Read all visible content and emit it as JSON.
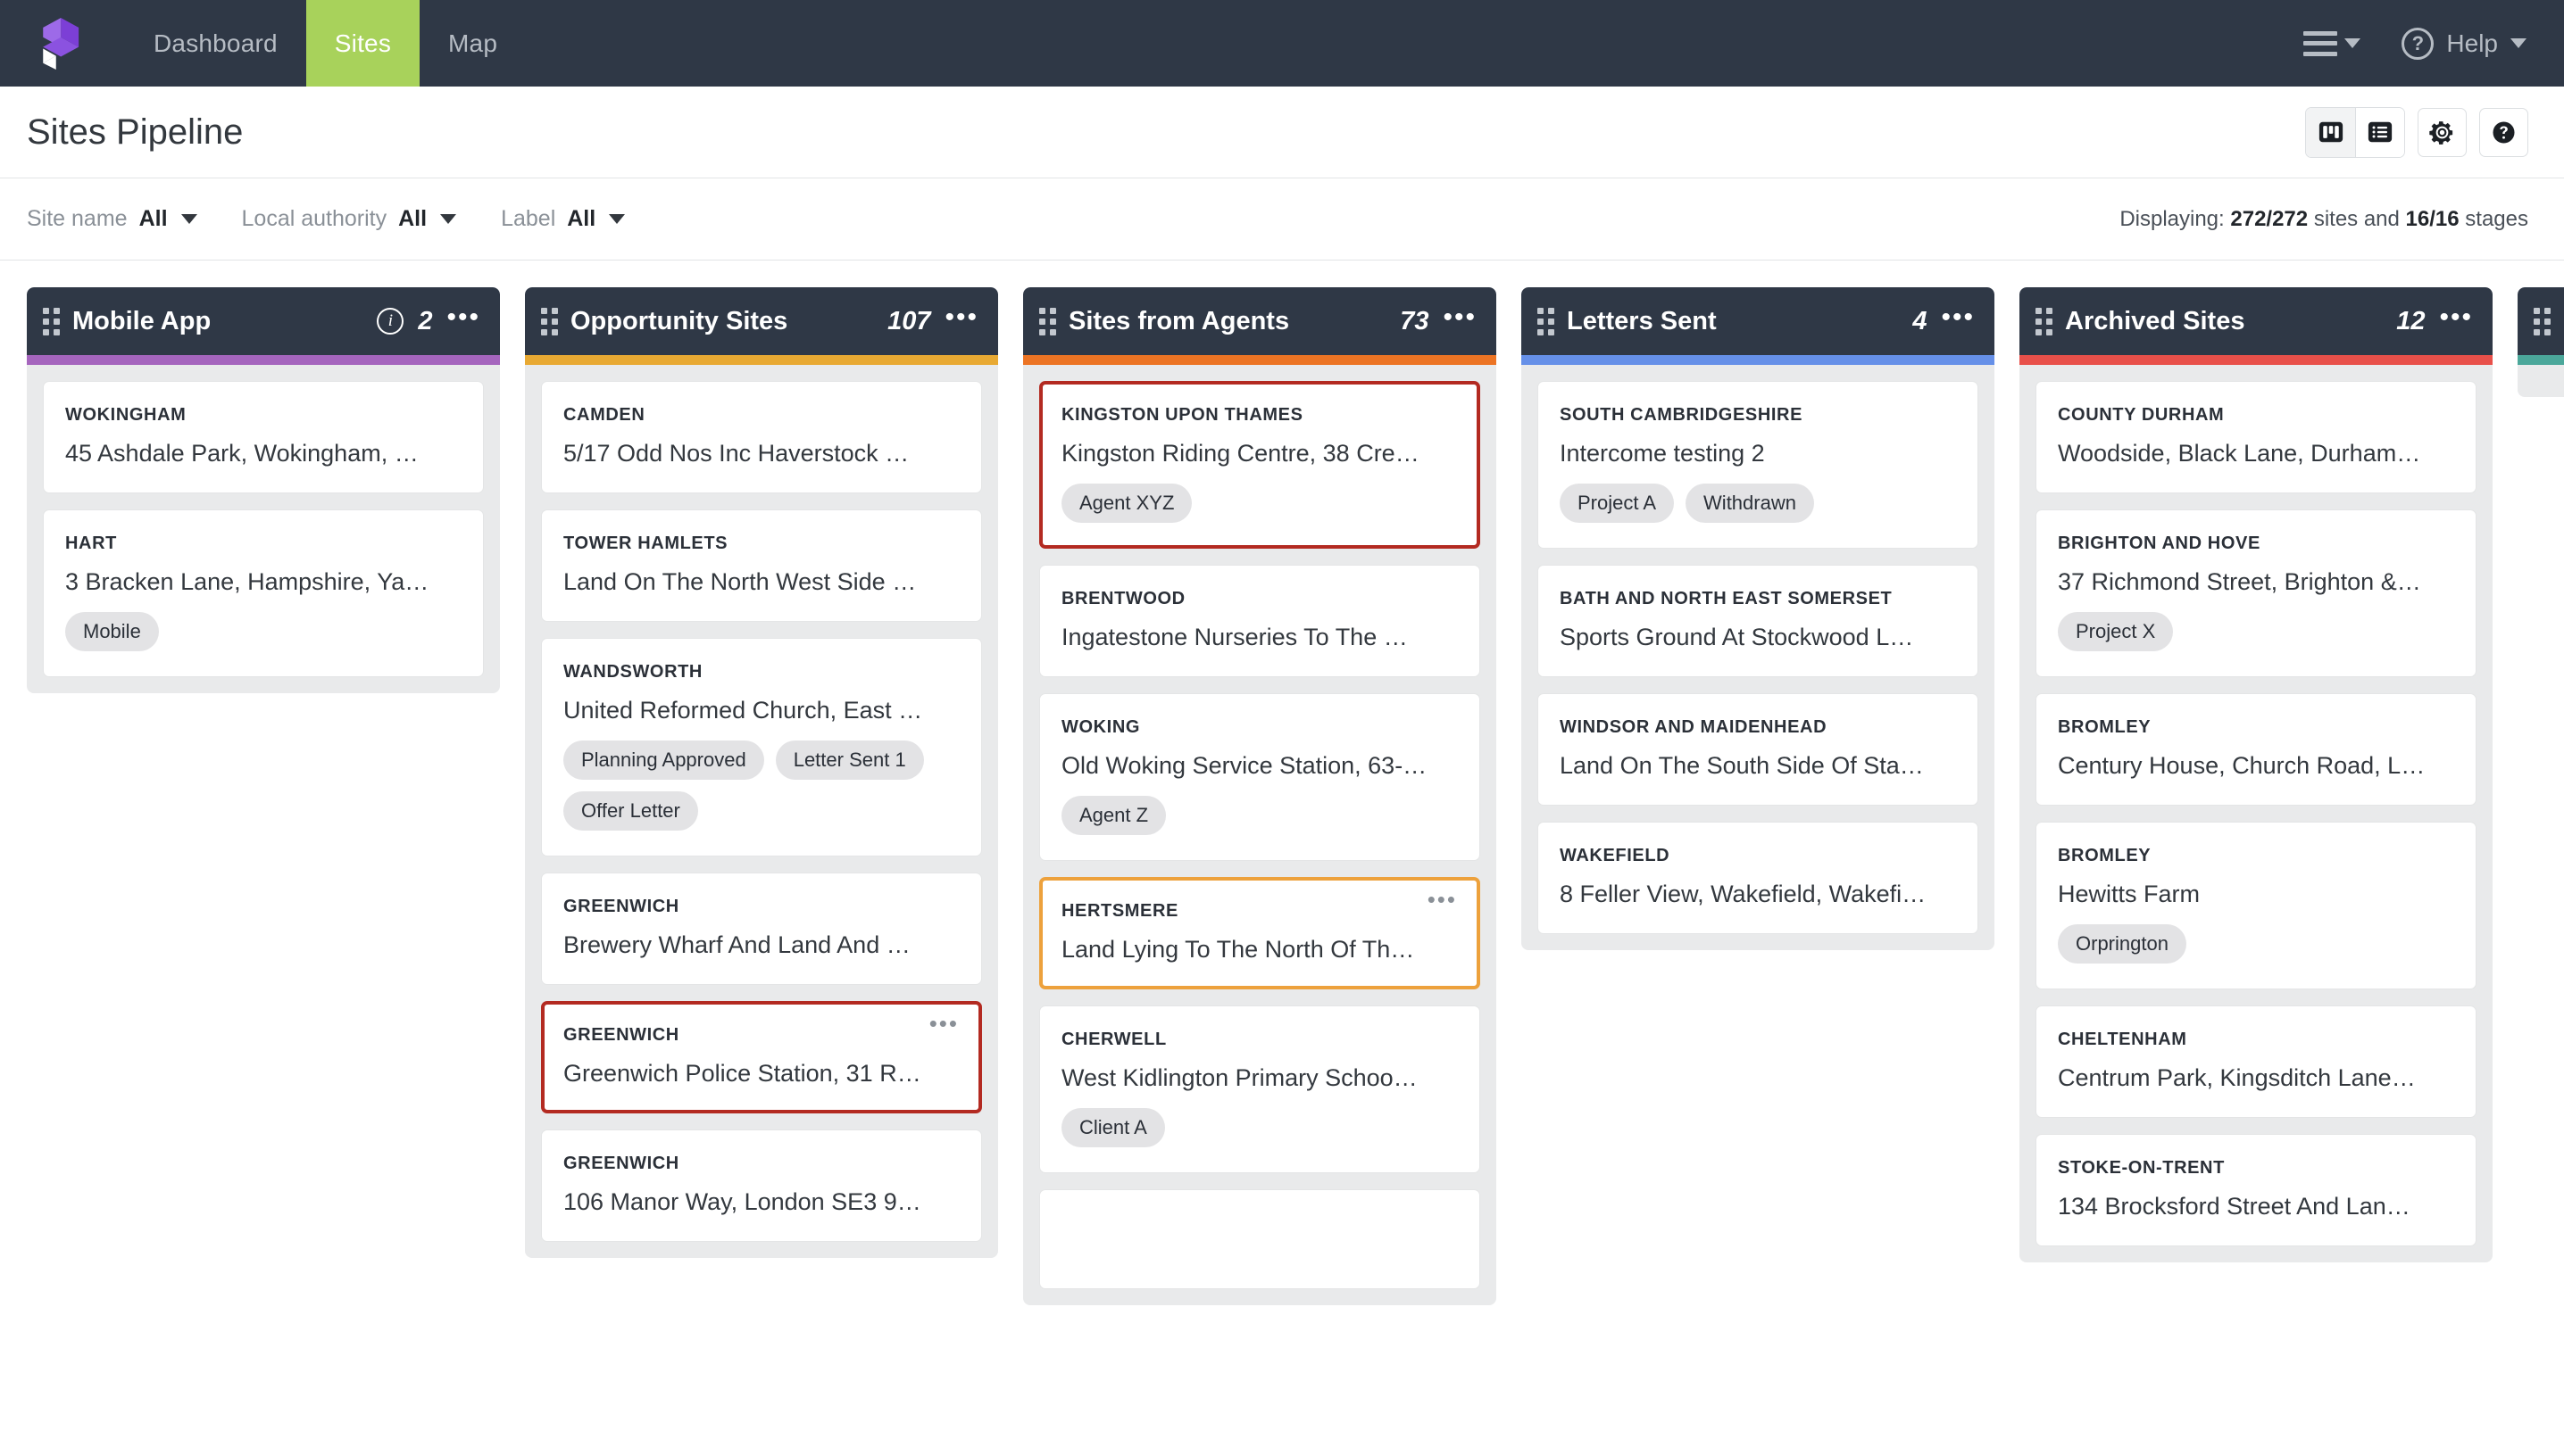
{
  "topnav": {
    "logo": "kanban-cube-logo",
    "items": [
      {
        "label": "Dashboard",
        "active": false
      },
      {
        "label": "Sites",
        "active": true
      },
      {
        "label": "Map",
        "active": false
      }
    ],
    "menu_icon": "hamburger-menu-icon",
    "help_label": "Help",
    "help_icon": "question-circle-icon"
  },
  "header": {
    "title": "Sites Pipeline",
    "tools": [
      {
        "name": "board-view-button",
        "icon": "kanban-board-icon",
        "selected": true
      },
      {
        "name": "list-view-button",
        "icon": "list-view-icon",
        "selected": false
      },
      {
        "name": "settings-button",
        "icon": "gear-icon",
        "selected": false
      },
      {
        "name": "help-button",
        "icon": "question-mark-circle-icon",
        "selected": false
      }
    ]
  },
  "filters": [
    {
      "label": "Site name",
      "value": "All"
    },
    {
      "label": "Local authority",
      "value": "All"
    },
    {
      "label": "Label",
      "value": "All"
    }
  ],
  "status": {
    "prefix": "Displaying:",
    "sites": "272/272",
    "middle": "sites and",
    "stages": "16/16",
    "suffix": "stages"
  },
  "columns": [
    {
      "title": "Mobile App",
      "count": "2",
      "accent": "#a565bd",
      "has_info": true,
      "cards": [
        {
          "authority": "WOKINGHAM",
          "name": "45 Ashdale Park, Wokingham, …",
          "tags": [],
          "highlight": "",
          "menu": false
        },
        {
          "authority": "HART",
          "name": "3 Bracken Lane, Hampshire, Ya…",
          "tags": [
            "Mobile"
          ],
          "highlight": "",
          "menu": false
        }
      ]
    },
    {
      "title": "Opportunity Sites",
      "count": "107",
      "accent": "#e8a933",
      "has_info": false,
      "cards": [
        {
          "authority": "CAMDEN",
          "name": "5/17 Odd Nos Inc Haverstock …",
          "tags": [],
          "highlight": "",
          "menu": false
        },
        {
          "authority": "TOWER HAMLETS",
          "name": "Land On The North West Side …",
          "tags": [],
          "highlight": "",
          "menu": false
        },
        {
          "authority": "WANDSWORTH",
          "name": "United Reformed Church, East …",
          "tags": [
            "Planning Approved",
            "Letter Sent 1",
            "Offer Letter"
          ],
          "highlight": "",
          "menu": false
        },
        {
          "authority": "GREENWICH",
          "name": "Brewery Wharf And Land And …",
          "tags": [],
          "highlight": "",
          "menu": false
        },
        {
          "authority": "GREENWICH",
          "name": "Greenwich Police Station, 31 R…",
          "tags": [],
          "highlight": "red",
          "menu": true
        },
        {
          "authority": "GREENWICH",
          "name": "106 Manor Way, London SE3 9…",
          "tags": [],
          "highlight": "",
          "menu": false
        }
      ]
    },
    {
      "title": "Sites from Agents",
      "count": "73",
      "accent": "#ec7424",
      "has_info": false,
      "cards": [
        {
          "authority": "KINGSTON UPON THAMES",
          "name": "Kingston Riding Centre, 38 Cre…",
          "tags": [
            "Agent XYZ"
          ],
          "highlight": "red",
          "menu": false
        },
        {
          "authority": "BRENTWOOD",
          "name": "Ingatestone Nurseries To The …",
          "tags": [],
          "highlight": "",
          "menu": false
        },
        {
          "authority": "WOKING",
          "name": "Old Woking Service Station, 63-…",
          "tags": [
            "Agent Z"
          ],
          "highlight": "",
          "menu": false
        },
        {
          "authority": "HERTSMERE",
          "name": "Land Lying To The North Of Th…",
          "tags": [],
          "highlight": "amber",
          "menu": true
        },
        {
          "authority": "CHERWELL",
          "name": "West Kidlington Primary Schoo…",
          "tags": [
            "Client A"
          ],
          "highlight": "",
          "menu": false
        },
        {
          "authority": "",
          "name": "",
          "tags": [],
          "highlight": "",
          "menu": false
        }
      ]
    },
    {
      "title": "Letters Sent",
      "count": "4",
      "accent": "#6690e8",
      "has_info": false,
      "cards": [
        {
          "authority": "SOUTH CAMBRIDGESHIRE",
          "name": "Intercome testing 2",
          "tags": [
            "Project A",
            "Withdrawn"
          ],
          "highlight": "",
          "menu": false
        },
        {
          "authority": "BATH AND NORTH EAST SOMERSET",
          "name": "Sports Ground At Stockwood L…",
          "tags": [],
          "highlight": "",
          "menu": false
        },
        {
          "authority": "WINDSOR AND MAIDENHEAD",
          "name": "Land On The South Side Of Sta…",
          "tags": [],
          "highlight": "",
          "menu": false
        },
        {
          "authority": "WAKEFIELD",
          "name": "8 Feller View, Wakefield, Wakefi…",
          "tags": [],
          "highlight": "",
          "menu": false
        }
      ]
    },
    {
      "title": "Archived Sites",
      "count": "12",
      "accent": "#e8504a",
      "has_info": false,
      "cards": [
        {
          "authority": "COUNTY DURHAM",
          "name": "Woodside, Black Lane, Durham…",
          "tags": [],
          "highlight": "",
          "menu": false
        },
        {
          "authority": "BRIGHTON AND HOVE",
          "name": "37 Richmond Street, Brighton &…",
          "tags": [
            "Project X"
          ],
          "highlight": "",
          "menu": false
        },
        {
          "authority": "BROMLEY",
          "name": "Century House, Church Road, L…",
          "tags": [],
          "highlight": "",
          "menu": false
        },
        {
          "authority": "BROMLEY",
          "name": "Hewitts Farm",
          "tags": [
            "Orprington"
          ],
          "highlight": "",
          "menu": false
        },
        {
          "authority": "CHELTENHAM",
          "name": "Centrum Park, Kingsditch Lane…",
          "tags": [],
          "highlight": "",
          "menu": false
        },
        {
          "authority": "STOKE-ON-TRENT",
          "name": "134 Brocksford Street And Lan…",
          "tags": [],
          "highlight": "",
          "menu": false
        }
      ]
    },
    {
      "title": "",
      "count": "",
      "accent": "#4ba79a",
      "has_info": false,
      "cards": []
    }
  ]
}
